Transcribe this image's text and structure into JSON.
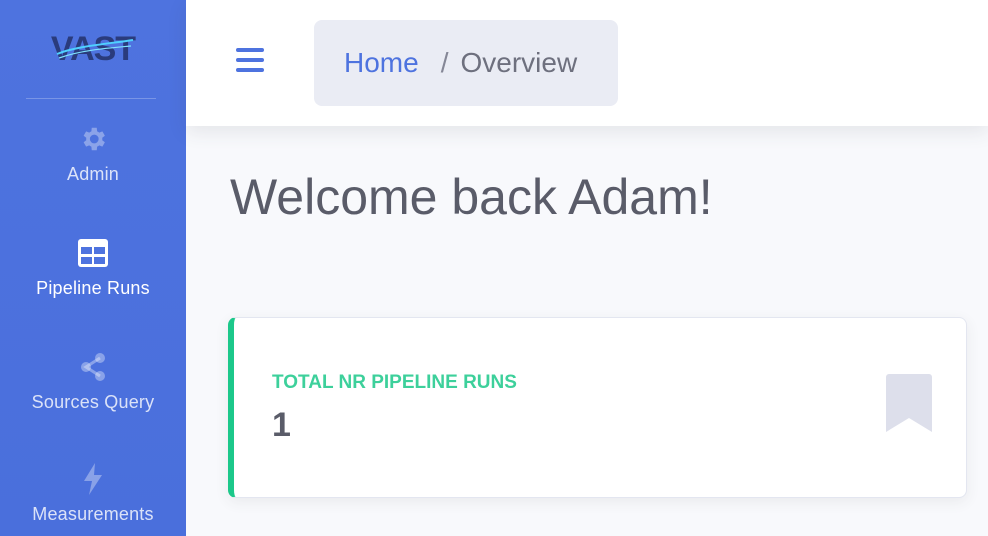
{
  "brand": {
    "logo_text": "VAST"
  },
  "sidebar": {
    "items": [
      {
        "label": "Admin",
        "icon": "gear-icon",
        "active": false
      },
      {
        "label": "Pipeline Runs",
        "icon": "table-icon",
        "active": true
      },
      {
        "label": "Sources Query",
        "icon": "share-icon",
        "active": false
      },
      {
        "label": "Measurements",
        "icon": "bolt-icon",
        "active": false
      }
    ]
  },
  "topbar": {
    "menu_icon": "hamburger-menu-icon",
    "breadcrumb": {
      "home": "Home",
      "separator": "/",
      "current": "Overview"
    }
  },
  "main": {
    "welcome": "Welcome back Adam!",
    "card": {
      "title": "TOTAL NR PIPELINE RUNS",
      "value": "1",
      "icon": "bookmark-icon"
    }
  },
  "colors": {
    "sidebar": "#4e73df",
    "accent": "#4e73df",
    "success": "#1cc88a",
    "text": "#5a5c69",
    "breadcrumb_bg": "#eaecf4"
  }
}
